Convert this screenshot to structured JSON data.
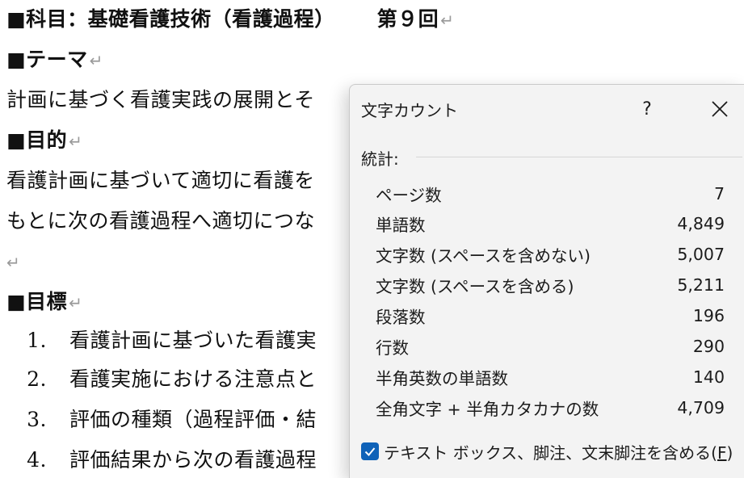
{
  "document": {
    "title_line": "■科目：基礎看護技術（看護過程）",
    "title_session": "第９回",
    "heading_theme": "■テーマ",
    "theme_text": "計画に基づく看護実践の展開とそ",
    "heading_purpose": "■目的",
    "purpose_line1": "看護計画に基づいて適切に看護を",
    "purpose_line2": "もとに次の看護過程へ適切につな",
    "heading_goals": "■目標",
    "goals": [
      {
        "num": "1.",
        "text": "看護計画に基づいた看護実"
      },
      {
        "num": "2.",
        "text": "看護実施における注意点と"
      },
      {
        "num": "3.",
        "text": "評価の種類（過程評価・結"
      },
      {
        "num": "4.",
        "text": "評価結果から次の看護過程"
      }
    ],
    "paragraph_mark": "↵"
  },
  "dialog": {
    "title": "文字カウント",
    "help_label": "?",
    "stats_label": "統計:",
    "stats": [
      {
        "label": "ページ数",
        "value": "7"
      },
      {
        "label": "単語数",
        "value": "4,849"
      },
      {
        "label": "文字数 (スペースを含めない)",
        "value": "5,007"
      },
      {
        "label": "文字数 (スペースを含める)",
        "value": "5,211"
      },
      {
        "label": "段落数",
        "value": "196"
      },
      {
        "label": "行数",
        "value": "290"
      },
      {
        "label": "半角英数の単語数",
        "value": "140"
      },
      {
        "label": "全角文字 + 半角カタカナの数",
        "value": "4,709"
      }
    ],
    "include_checkbox": {
      "label": "テキスト ボックス、脚注、文末脚注を含める(",
      "accel": "F",
      "label_end": ")",
      "checked": true
    }
  },
  "colors": {
    "checkbox_accent": "#0f62b8",
    "dialog_bg": "#f3f3f3"
  }
}
